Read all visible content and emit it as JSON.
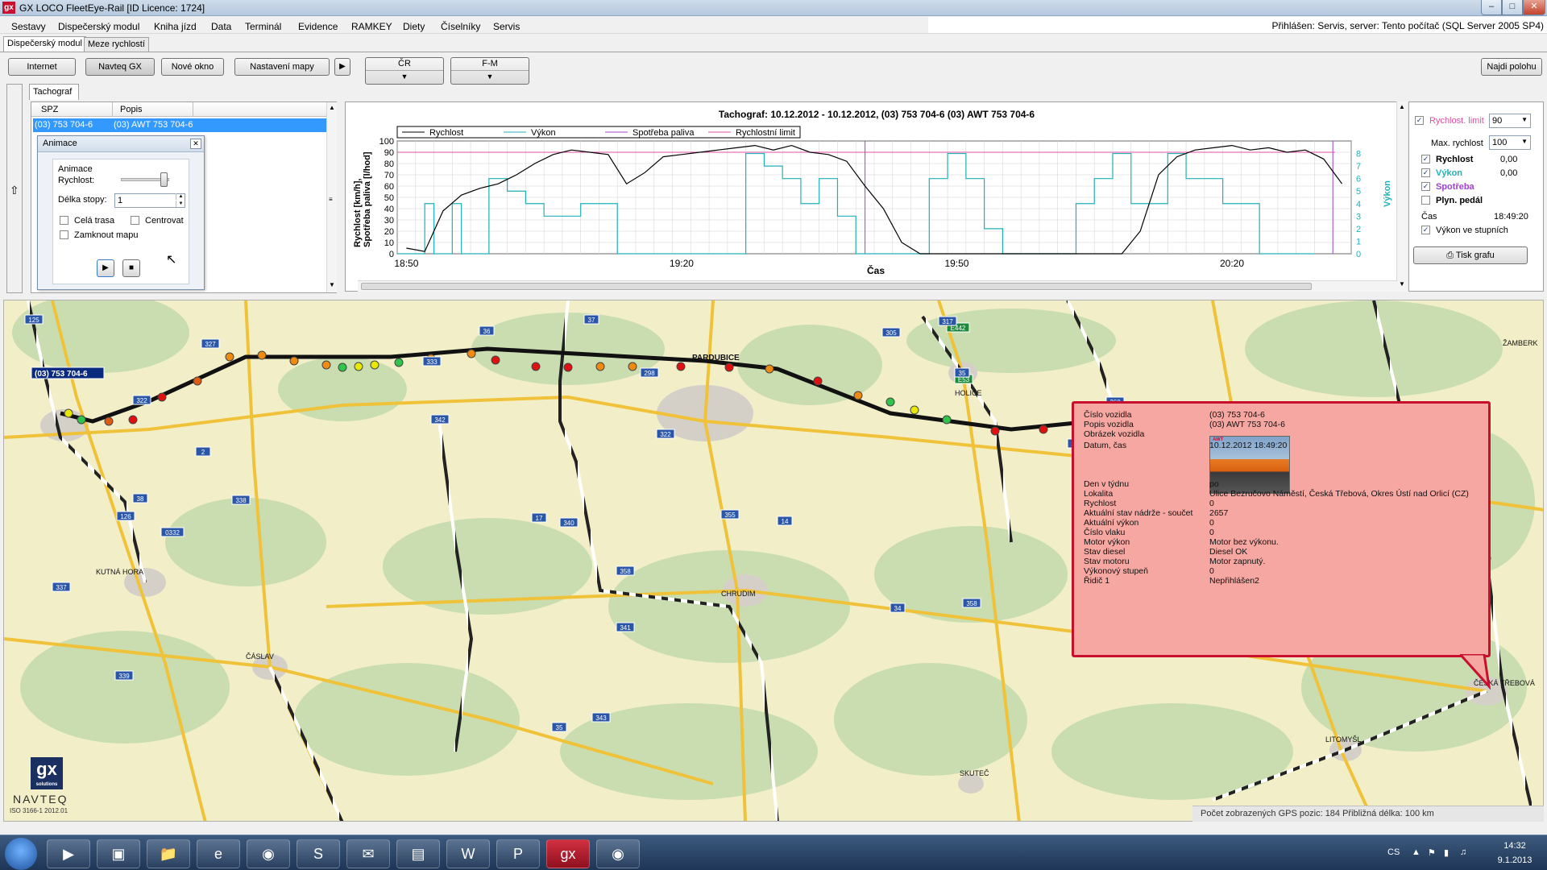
{
  "window": {
    "title": "GX LOCO FleetEye-Rail  [ID Licence: 1724]",
    "icon": "gx-icon",
    "controls": [
      "minimize-icon",
      "maximize-icon",
      "close-icon"
    ]
  },
  "menu": {
    "items": [
      "Sestavy",
      "Dispečerský modul",
      "Kniha jízd",
      "Data",
      "Terminál",
      "Evidence",
      "RAMKEY",
      "Diety",
      "Číselníky",
      "Servis"
    ],
    "login": "Přihlášen: Servis, server: Tento počítač (SQL Server 2005 SP4)"
  },
  "module_tabs": [
    "Dispečerský modul",
    "Meze rychlostí"
  ],
  "toolbar": {
    "internet": "Internet",
    "navteq": "Navteq GX",
    "new_window": "Nové okno",
    "map_settings": "Nastavení mapy",
    "combo_cr": "ČR",
    "combo_fm": "F-M",
    "find_position": "Najdi polohu"
  },
  "tacho_tab": "Tachograf",
  "vehicle_list": {
    "columns": [
      "SPZ",
      "Popis"
    ],
    "rows": [
      {
        "spz": "(03) 753 704-6",
        "popis": "(03) AWT 753 704-6"
      }
    ]
  },
  "animace": {
    "title": "Animace",
    "speed_label": "Animace\nRychlost:",
    "speed_label_1": "Animace",
    "speed_label_2": "Rychlost:",
    "trail_label": "Délka stopy:",
    "trail_value": "1",
    "whole_route": "Celá trasa",
    "center": "Centrovat",
    "lock_map": "Zamknout mapu"
  },
  "chart_data": {
    "type": "line",
    "title": "Tachograf: 10.12.2012 - 10.12.2012, (03) 753 704-6  (03) AWT 753 704-6",
    "xlabel": "Čas",
    "ylabel": "Rychlost [km/h],\nSpotřeba paliva [l/hod]",
    "ylabel_1": "Rychlost [km/h],",
    "ylabel_2": "Spotřeba paliva [l/hod]",
    "y2label": "Výkon",
    "x_ticks": [
      "18:50",
      "19:20",
      "19:50",
      "20:20"
    ],
    "y_ticks": [
      0,
      10,
      20,
      30,
      40,
      50,
      60,
      70,
      80,
      90,
      100
    ],
    "y2_ticks": [
      0,
      1,
      2,
      3,
      4,
      5,
      6,
      7,
      8
    ],
    "ylim": [
      0,
      100
    ],
    "y2lim": [
      0,
      9
    ],
    "legend_position": "top-left",
    "grid": true,
    "series": [
      {
        "name": "Rychlost",
        "color": "#000000",
        "axis": "left",
        "x": [
          "18:50",
          "18:52",
          "18:54",
          "18:56",
          "18:58",
          "19:00",
          "19:02",
          "19:04",
          "19:06",
          "19:08",
          "19:10",
          "19:12",
          "19:14",
          "19:16",
          "19:18",
          "19:20",
          "19:22",
          "19:24",
          "19:26",
          "19:28",
          "19:30",
          "19:32",
          "19:34",
          "19:36",
          "19:38",
          "19:40",
          "19:42",
          "19:44",
          "19:46",
          "19:48",
          "19:50",
          "19:52",
          "19:54",
          "19:56",
          "19:58",
          "20:00",
          "20:02",
          "20:04",
          "20:06",
          "20:08",
          "20:10",
          "20:12",
          "20:14",
          "20:16",
          "20:18",
          "20:20",
          "20:22",
          "20:24",
          "20:26",
          "20:28",
          "20:30",
          "20:32"
        ],
        "values": [
          5,
          2,
          38,
          52,
          58,
          62,
          70,
          80,
          88,
          92,
          90,
          88,
          62,
          72,
          86,
          88,
          90,
          92,
          94,
          96,
          92,
          96,
          90,
          88,
          82,
          60,
          40,
          10,
          0,
          0,
          0,
          0,
          0,
          0,
          0,
          0,
          0,
          0,
          0,
          0,
          20,
          70,
          86,
          92,
          94,
          96,
          92,
          94,
          90,
          92,
          84,
          62
        ]
      },
      {
        "name": "Výkon",
        "color": "#20b0b8",
        "axis": "right",
        "values_note": "stepped power level 0-8"
      },
      {
        "name": "Spotřeba paliva",
        "color": "#a040d0",
        "axis": "left"
      },
      {
        "name": "Rychlostní limit",
        "color": "#e050a0",
        "axis": "left",
        "values": [
          90
        ]
      }
    ]
  },
  "options": {
    "speed_limit_label": "Rychlost. limit",
    "speed_limit_value": "90",
    "max_speed_label": "Max. rychlost",
    "max_speed_value": "100",
    "rychlost_label": "Rychlost",
    "rychlost_value": "0,00",
    "vykon_label": "Výkon",
    "vykon_value": "0,00",
    "spotreba_label": "Spotřeba",
    "plyn_label": "Plyn. pedál",
    "cas_label": "Čas",
    "cas_value": "18:49:20",
    "vykon_stupne_label": "Výkon ve stupních",
    "print_label": "Tisk grafu",
    "colors": {
      "limit": "#e050a0",
      "vykon": "#20b0b8",
      "spotreba": "#a040d0"
    }
  },
  "map": {
    "vehicle_label": "(03) 753 704-6",
    "cities": [
      "PARDUBICE",
      "HOLICE",
      "CHRUDIM",
      "KUTNÁ HORA",
      "ČÁSLAV",
      "ČESKÁ TŘEBOVÁ",
      "LITOMYŠL",
      "SKUTEČ",
      "ŽAMBERK"
    ],
    "road_shields": [
      "125",
      "327",
      "322",
      "2",
      "38",
      "126",
      "338",
      "0332",
      "337",
      "339",
      "37",
      "36",
      "333",
      "342",
      "17",
      "340",
      "358",
      "341",
      "343",
      "35",
      "E442",
      "E53",
      "298",
      "305",
      "317",
      "355",
      "356",
      "14",
      "358",
      "360",
      "34",
      "322",
      "35"
    ],
    "status": "Počet zobrazených GPS pozic: 184  Přibližná délka: 100 km",
    "brand_logo": "gx",
    "brand_logo_sub": "solutions",
    "navteq": "NAVTEQ",
    "iso": "ISO 3166-1 2012.01"
  },
  "popup": {
    "rows": [
      {
        "label": "Číslo vozidla",
        "value": "(03) 753 704-6"
      },
      {
        "label": "Popis vozidla",
        "value": "(03) AWT 753 704-6"
      },
      {
        "label": "Obrázek vozidla",
        "value": ""
      },
      {
        "label": "Datum, čas",
        "value": "10.12.2012 18:49:20"
      },
      {
        "label": "Den v týdnu",
        "value": "po"
      },
      {
        "label": "Lokalita",
        "value": "Ulice Bezručovo Náměstí, Česká Třebová, Okres Ústí nad Orlicí (CZ)"
      },
      {
        "label": "Rychlost",
        "value": "0"
      },
      {
        "label": "Aktuální stav nádrže - součet",
        "value": "2657"
      },
      {
        "label": "Aktuální výkon",
        "value": "0"
      },
      {
        "label": "Číslo vlaku",
        "value": "0"
      },
      {
        "label": "Motor výkon",
        "value": "Motor bez výkonu."
      },
      {
        "label": "Stav diesel",
        "value": "Diesel OK"
      },
      {
        "label": "Stav motoru",
        "value": "Motor zapnutý."
      },
      {
        "label": "Výkonový stupeň",
        "value": "0"
      },
      {
        "label": "Řidič 1",
        "value": "Nepřihlášen2"
      }
    ],
    "image_logo": "AWT"
  },
  "taskbar": {
    "apps": [
      "start-orb",
      "media-player-icon",
      "app-icon",
      "folder-icon",
      "ie-icon",
      "chrome-icon",
      "skype-icon",
      "mail-icon",
      "save-icon",
      "word-icon",
      "powerpoint-icon",
      "gx-icon",
      "camera-icon"
    ],
    "language": "CS",
    "time": "14:32",
    "date": "9.1.2013"
  }
}
